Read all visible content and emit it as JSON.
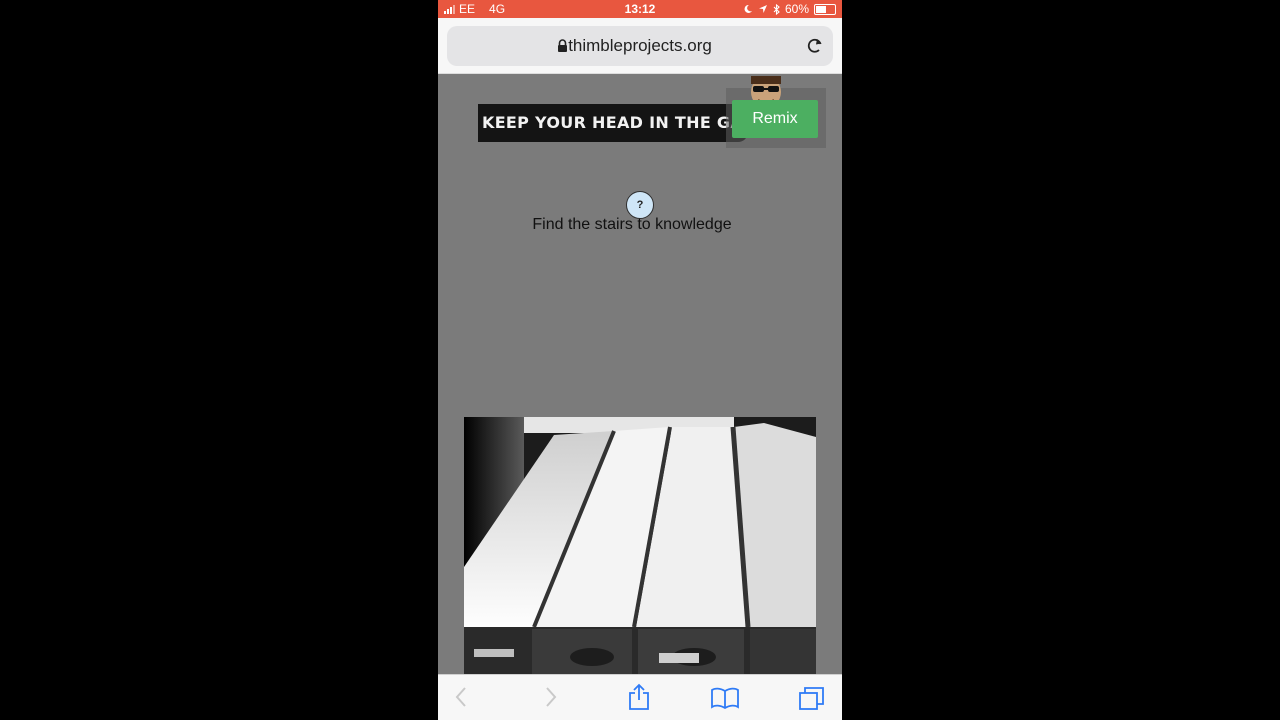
{
  "status_bar": {
    "carrier": "EE",
    "network": "4G",
    "time": "13:12",
    "battery_percent": "60%",
    "battery_level": 0.6,
    "background_color": "#e8573f"
  },
  "browser": {
    "url": "thimbleprojects.org",
    "icons": [
      "lock-icon",
      "reload-icon",
      "back-icon",
      "forward-icon",
      "share-icon",
      "bookmarks-icon",
      "tabs-icon"
    ]
  },
  "page": {
    "banner_text": "KEEP YOUR HEAD IN THE GA",
    "remix_label": "Remix",
    "remix_color": "#4caf61",
    "help_symbol": "?",
    "prompt": "Find the stairs to knowledge",
    "background_color": "#7b7b7b"
  }
}
